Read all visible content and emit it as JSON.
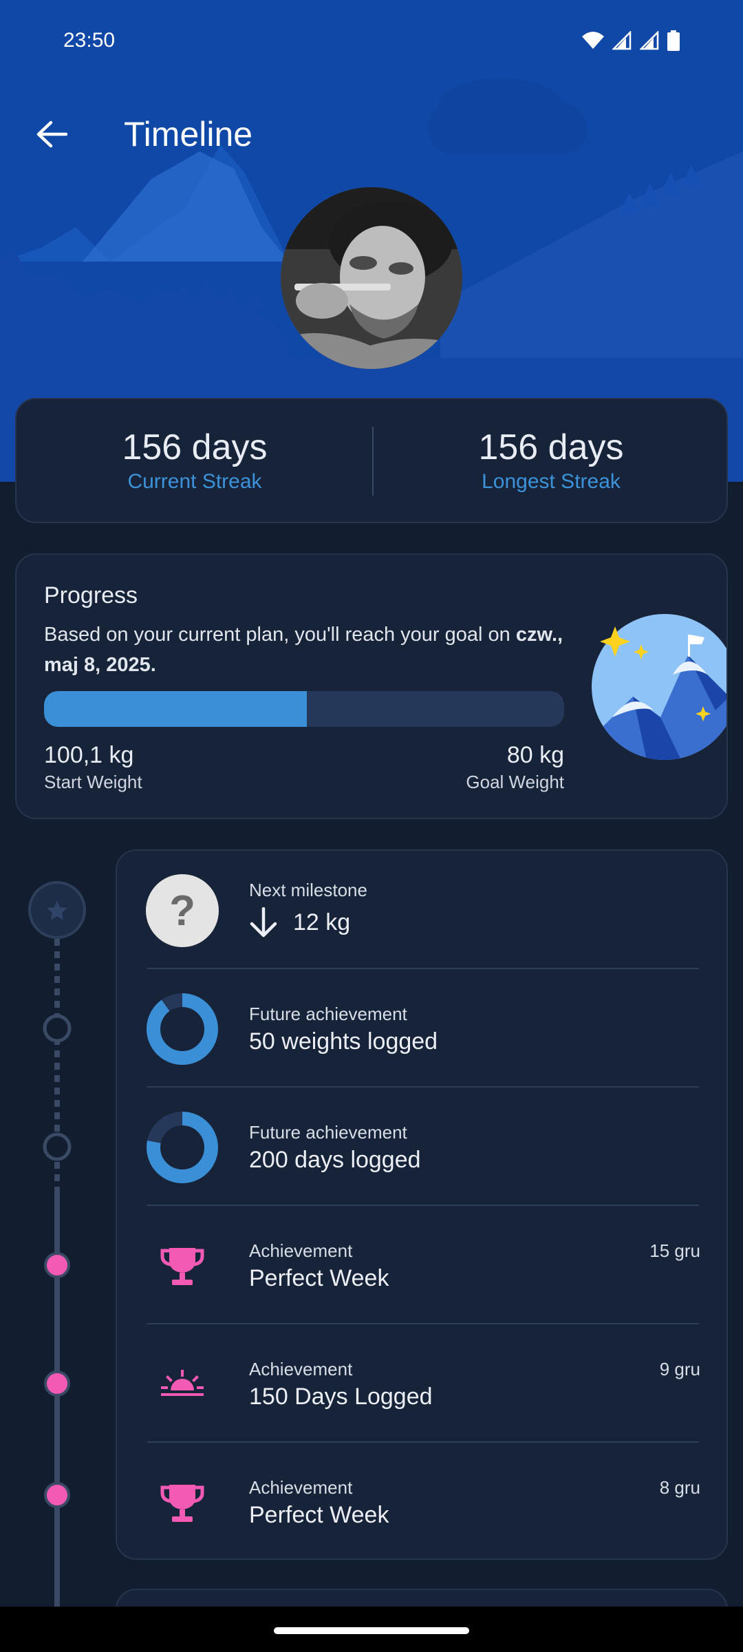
{
  "status_bar": {
    "time": "23:50"
  },
  "app_bar": {
    "title": "Timeline"
  },
  "streaks": {
    "current": {
      "value": "156 days",
      "label": "Current Streak"
    },
    "longest": {
      "value": "156 days",
      "label": "Longest Streak"
    }
  },
  "progress": {
    "title": "Progress",
    "description": "Based on your current plan, you'll reach your goal on",
    "goal_date": "czw., maj 8, 2025.",
    "progress_fraction": 0.505,
    "start_weight": {
      "value": "100,1 kg",
      "label": "Start Weight"
    },
    "goal_weight": {
      "value": "80 kg",
      "label": "Goal Weight"
    }
  },
  "timeline": {
    "next_milestone": {
      "kind": "Next milestone",
      "value": "12 kg",
      "icon": "arrow-down-icon"
    },
    "items": [
      {
        "kind": "Future achievement",
        "name": "50 weights logged",
        "date": "",
        "icon": "donut-progress-icon",
        "progress": 0.9
      },
      {
        "kind": "Future achievement",
        "name": "200 days logged",
        "date": "",
        "icon": "donut-progress-icon",
        "progress": 0.78
      },
      {
        "kind": "Achievement",
        "name": "Perfect Week",
        "date": "15 gru",
        "icon": "trophy-icon"
      },
      {
        "kind": "Achievement",
        "name": "150 Days Logged",
        "date": "9 gru",
        "icon": "sunrise-icon"
      },
      {
        "kind": "Achievement",
        "name": "Perfect Week",
        "date": "8 gru",
        "icon": "trophy-icon"
      }
    ]
  },
  "colors": {
    "header_bg": "#1048a8",
    "page_bg": "#121e30",
    "card_bg": "#172338",
    "accent_blue": "#3b8fd6",
    "achievement_pink": "#f25ab4"
  }
}
